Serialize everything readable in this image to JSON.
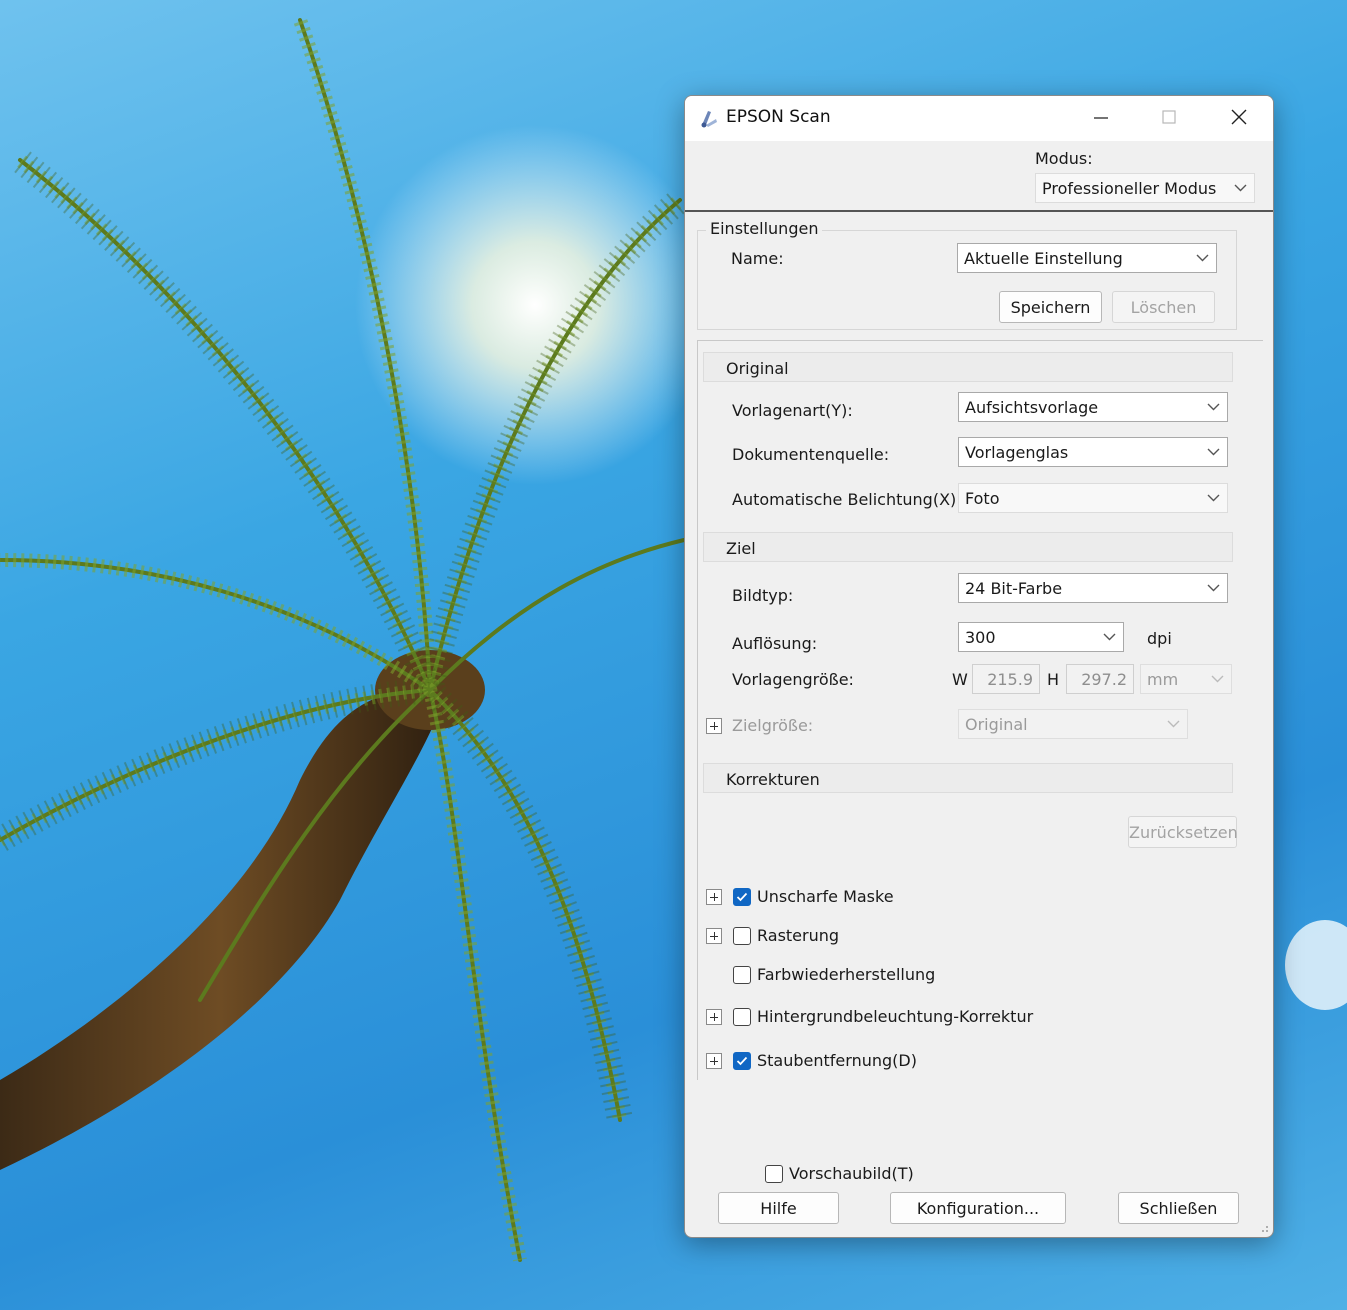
{
  "window": {
    "title": "EPSON Scan",
    "controls": {
      "minimize": "minimize-icon",
      "maximize": "maximize-icon",
      "close": "close-icon"
    }
  },
  "mode": {
    "label": "Modus:",
    "value": "Professioneller Modus"
  },
  "einstellungen": {
    "legend": "Einstellungen",
    "name_label": "Name:",
    "name_value": "Aktuelle Einstellung",
    "save_label": "Speichern",
    "delete_label": "Löschen"
  },
  "original": {
    "header": "Original",
    "vorlagenart_label": "Vorlagenart(Y):",
    "vorlagenart_value": "Aufsichtsvorlage",
    "dokumentenquelle_label": "Dokumentenquelle:",
    "dokumentenquelle_value": "Vorlagenglas",
    "belichtung_label": "Automatische Belichtung(X):",
    "belichtung_value": "Foto"
  },
  "ziel": {
    "header": "Ziel",
    "bildtyp_label": "Bildtyp:",
    "bildtyp_value": "24 Bit-Farbe",
    "aufloesung_label": "Auflösung:",
    "aufloesung_value": "300",
    "aufloesung_unit": "dpi",
    "vorlagengroesse_label": "Vorlagengröße:",
    "w_label": "W",
    "w_value": "215.9",
    "h_label": "H",
    "h_value": "297.2",
    "unit_value": "mm",
    "zielgroesse_label": "Zielgröße:",
    "zielgroesse_value": "Original"
  },
  "korrekturen": {
    "header": "Korrekturen",
    "reset_label": "Zurücksetzen",
    "items": [
      {
        "label": "Unscharfe Maske",
        "checked": true,
        "expandable": true
      },
      {
        "label": "Rasterung",
        "checked": false,
        "expandable": true
      },
      {
        "label": "Farbwiederherstellung",
        "checked": false,
        "expandable": false
      },
      {
        "label": "Hintergrundbeleuchtung-Korrektur",
        "checked": false,
        "expandable": true
      },
      {
        "label": "Staubentfernung(D)",
        "checked": true,
        "expandable": true
      }
    ]
  },
  "footer": {
    "preview_label": "Vorschaubild(T)",
    "preview_checked": false,
    "help_label": "Hilfe",
    "config_label": "Konfiguration...",
    "close_label": "Schließen"
  }
}
